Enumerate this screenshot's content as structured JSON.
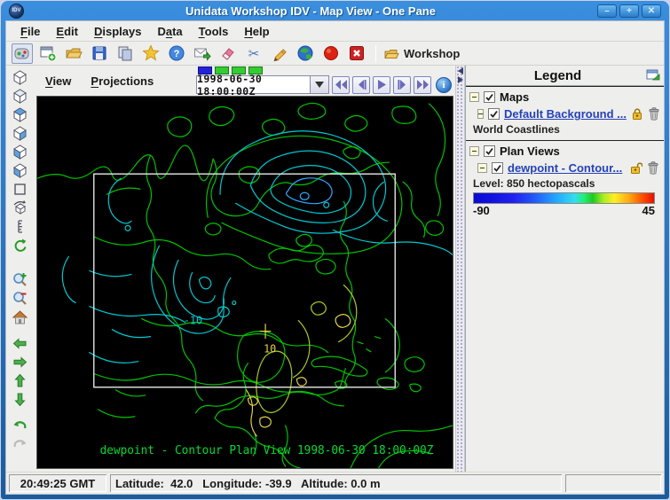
{
  "window": {
    "title": "Unidata Workshop IDV - Map View - One Pane",
    "logo_text": "IDV",
    "buttons": {
      "minimize": "–",
      "maximize": "+",
      "close": "✕"
    }
  },
  "menubar": {
    "items": [
      {
        "label": "File",
        "u": 0
      },
      {
        "label": "Edit",
        "u": 0
      },
      {
        "label": "Displays",
        "u": 0
      },
      {
        "label": "Data",
        "u": 1
      },
      {
        "label": "Tools",
        "u": 0
      },
      {
        "label": "Help",
        "u": 0
      }
    ]
  },
  "toolbar": {
    "workshop_label": "Workshop",
    "icons": [
      "dashboard",
      "new-window",
      "open-folder",
      "save",
      "copy",
      "favorites-star",
      "help",
      "support-email",
      "eraser",
      "cut-scissors",
      "draw-pencil",
      "globe",
      "stop",
      "exit",
      "workshop-folder"
    ]
  },
  "viewpanel": {
    "menus": [
      {
        "label": "View",
        "u": 0
      },
      {
        "label": "Projections",
        "u": 0
      }
    ],
    "timeline": {
      "steps": 4,
      "active_index": 0,
      "active_color": "#2222dd",
      "step_color": "#33cc33",
      "border_color": "#1a7a1a"
    },
    "time_value": "1998-06-30 18:00:00Z",
    "nav_icons": [
      "go-first",
      "step-back",
      "play",
      "step-forward",
      "go-last",
      "info"
    ],
    "map": {
      "caption": "dewpoint - Contour Plan View 1998-06-30 18:00:00Z",
      "contour_label_negative": "-10",
      "contour_label_positive": "10",
      "coast_color": "#00c400",
      "contour_cyan": "#00c9d2",
      "contour_yellow_green": "#a8cc22",
      "contour_yellow": "#e3d24e",
      "caption_color": "#00dd33",
      "select_box_color": "#e8e8e8"
    }
  },
  "legend": {
    "title": "Legend",
    "maps_section": {
      "label": "Maps",
      "link": "Default Background ...",
      "sub": "World Coastlines"
    },
    "plan_views_section": {
      "label": "Plan Views",
      "link": "dewpoint - Contour...",
      "level": "Level: 850 hectopascals",
      "colorbar": {
        "min": "-90",
        "max": "45",
        "stops": [
          "#0a0ad2 0%",
          "#1414e4 12%",
          "#2222f0 22%",
          "#2256f8 33%",
          "#22aaff 46%",
          "#33ddf0 56%",
          "#22ee77 61%",
          "#1fc822 66%",
          "#aaee22 72%",
          "#ffee22 78%",
          "#ffaa11 86%",
          "#ff5500 93%",
          "#e81000 100%"
        ]
      }
    }
  },
  "statusbar": {
    "time": "20:49:25 GMT",
    "position": "Latitude:  42.0   Longitude: -39.9   Altitude: 0.0 m"
  }
}
